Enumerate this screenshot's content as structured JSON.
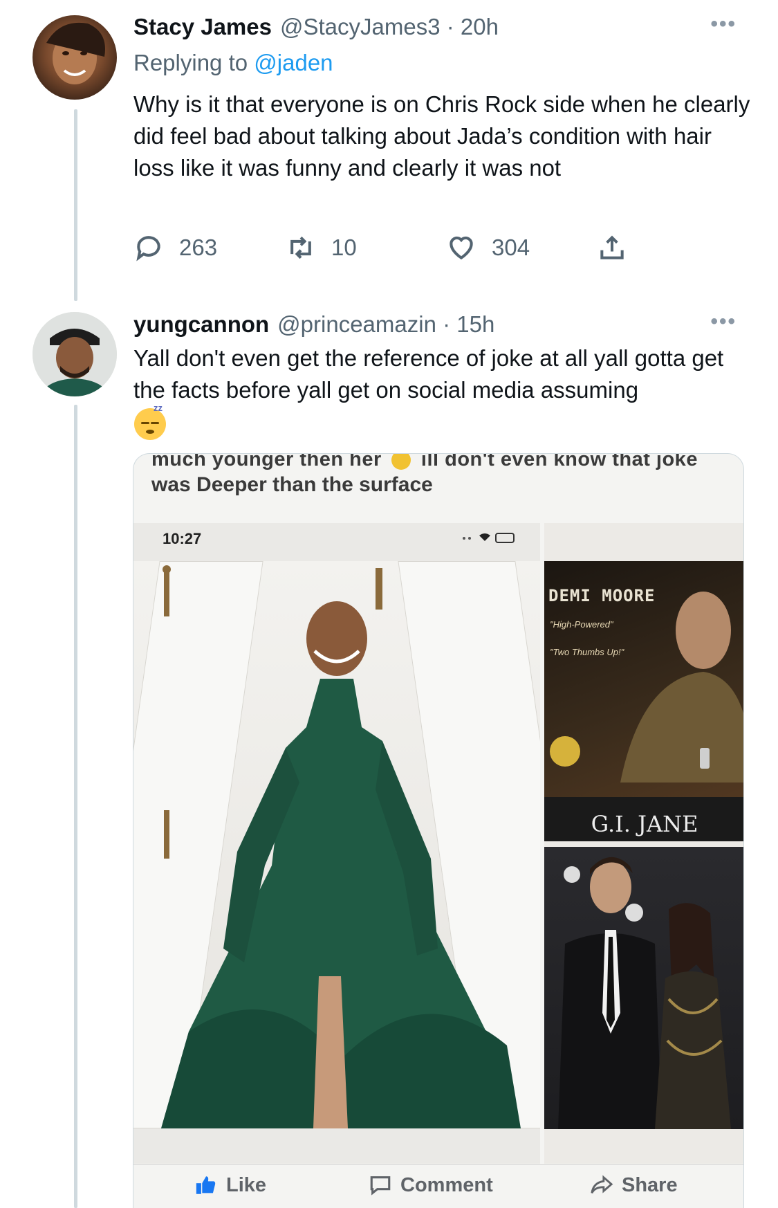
{
  "tweets": [
    {
      "name": "Stacy James",
      "handle": "@StacyJames3 · 20h",
      "replying_prefix": "Replying to",
      "replying_mention": "@jaden",
      "text": "Why is it that everyone is on Chris Rock side when he clearly did feel bad about talking about Jada’s condition with hair loss  like it was funny and clearly it was not",
      "actions": {
        "replies": "263",
        "retweets": "10",
        "likes": "304"
      },
      "more": "•••"
    },
    {
      "name": "yungcannon",
      "handle": "@princeamazin · 15h",
      "text": "Yall don't even get the reference of joke at all yall gotta get the facts before yall get on social media assuming",
      "emoji": "sleeping-face",
      "more": "•••",
      "media": {
        "cut_text_left": "much younger then her",
        "cut_text_right": "ill don't even know that joke",
        "caption": "was Deeper than the surface",
        "phone_time": "10:27",
        "poster_title": "DEMI MOORE",
        "poster_quote1": "\"High-Powered\"",
        "poster_quote2": "\"Two Thumbs Up!\"",
        "poster_movie": "G.I. JANE",
        "fb_like": "Like",
        "fb_comment": "Comment",
        "fb_share": "Share"
      }
    }
  ],
  "colors": {
    "link_blue": "#1d9bf0",
    "secondary_text": "#536471",
    "thread_line": "#cfd9de"
  }
}
